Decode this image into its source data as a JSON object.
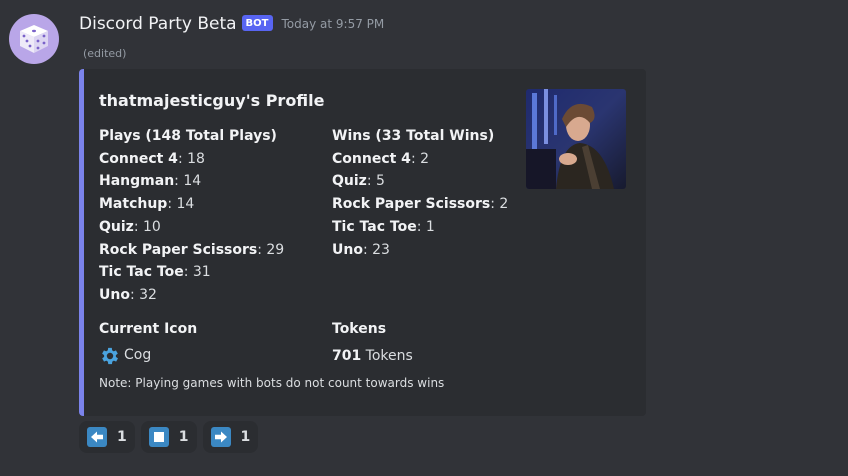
{
  "message": {
    "username": "Discord Party Beta",
    "bot_tag": "BOT",
    "timestamp": "Today at 9:57 PM",
    "edited": "(edited)"
  },
  "embed": {
    "title": "thatmajesticguy's Profile",
    "accent_color": "#7b83eb",
    "plays": {
      "name": "Plays (148 Total Plays)",
      "items": [
        {
          "game": "Connect 4",
          "value": ": 18"
        },
        {
          "game": "Hangman",
          "value": ": 14"
        },
        {
          "game": "Matchup",
          "value": ": 14"
        },
        {
          "game": "Quiz",
          "value": ": 10"
        },
        {
          "game": "Rock Paper Scissors",
          "value": ": 29"
        },
        {
          "game": "Tic Tac Toe",
          "value": ": 31"
        },
        {
          "game": "Uno",
          "value": ": 32"
        }
      ]
    },
    "wins": {
      "name": "Wins (33 Total Wins)",
      "items": [
        {
          "game": "Connect 4",
          "value": ": 2"
        },
        {
          "game": "Quiz",
          "value": ": 5"
        },
        {
          "game": "Rock Paper Scissors",
          "value": ": 2"
        },
        {
          "game": "Tic Tac Toe",
          "value": ": 1"
        },
        {
          "game": "Uno",
          "value": ": 23"
        }
      ]
    },
    "current_icon": {
      "name": "Current Icon",
      "icon": "gear-icon",
      "value": "Cog"
    },
    "tokens": {
      "name": "Tokens",
      "amount": "701",
      "unit": " Tokens"
    },
    "footer": "Note: Playing games with bots do not count towards wins"
  },
  "reactions": [
    {
      "icon": "arrow-left-icon",
      "count": "1"
    },
    {
      "icon": "stop-icon",
      "count": "1"
    },
    {
      "icon": "arrow-right-icon",
      "count": "1"
    }
  ]
}
